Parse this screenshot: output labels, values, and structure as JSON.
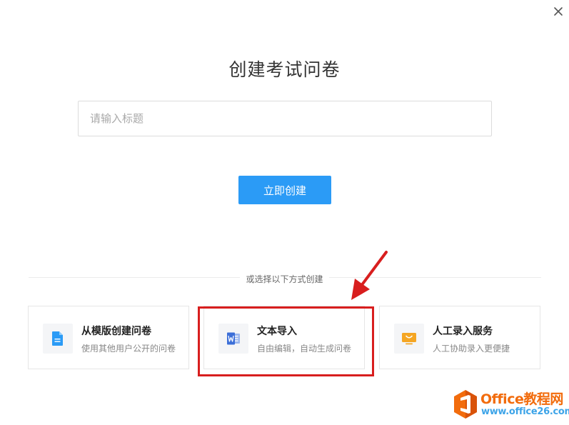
{
  "dialog": {
    "title": "创建考试问卷",
    "title_input": {
      "placeholder": "请输入标题",
      "value": ""
    },
    "create_button_label": "立即创建",
    "divider_text": "或选择以下方式创建"
  },
  "options": [
    {
      "title": "从模版创建问卷",
      "description": "使用其他用户公开的问卷",
      "icon": "document-icon",
      "icon_color": "#2b9bf6"
    },
    {
      "title": "文本导入",
      "description": "自由编辑，自动生成问卷",
      "icon": "word-icon",
      "icon_color": "#3c6fd8"
    },
    {
      "title": "人工录入服务",
      "description": "人工协助录入更便捷",
      "icon": "monitor-icon",
      "icon_color": "#f5a623"
    }
  ],
  "watermark": {
    "brand": "Office教程网",
    "url": "www.office26.com"
  },
  "colors": {
    "primary": "#2b9bf6",
    "highlight": "#d81e1e",
    "watermark_orange": "#f26c0d",
    "watermark_blue": "#3da4e8"
  }
}
